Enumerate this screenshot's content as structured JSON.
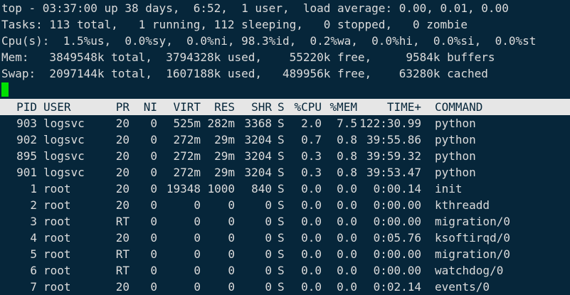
{
  "summary": {
    "uptime": "top - 03:37:00 up 38 days,  6:52,  1 user,  load average: 0.00, 0.01, 0.00",
    "tasks": "Tasks: 113 total,   1 running, 112 sleeping,   0 stopped,   0 zombie",
    "cpu": "Cpu(s):  1.5%us,  0.0%sy,  0.0%ni, 98.3%id,  0.2%wa,  0.0%hi,  0.0%si,  0.0%st",
    "mem": "Mem:   3849548k total,  3794328k used,    55220k free,     9584k buffers",
    "swap": "Swap:  2097144k total,  1607188k used,   489956k free,    63280k cached"
  },
  "colors": {
    "background": "#06263a",
    "foreground": "#dcdcdc",
    "header_bar": "#e6e6e6",
    "cursor": "#00e000"
  },
  "columns": [
    "PID",
    "USER",
    "PR",
    "NI",
    "VIRT",
    "RES",
    "SHR",
    "S",
    "%CPU",
    "%MEM",
    "TIME+",
    "COMMAND"
  ],
  "processes": [
    {
      "pid": "903",
      "user": "logsvc",
      "pr": "20",
      "ni": "0",
      "virt": "525m",
      "res": "282m",
      "shr": "3368",
      "s": "S",
      "cpu": "2.0",
      "mem": "7.5",
      "time": "122:30.99",
      "command": "python"
    },
    {
      "pid": "902",
      "user": "logsvc",
      "pr": "20",
      "ni": "0",
      "virt": "272m",
      "res": "29m",
      "shr": "3204",
      "s": "S",
      "cpu": "0.7",
      "mem": "0.8",
      "time": "39:55.86",
      "command": "python"
    },
    {
      "pid": "895",
      "user": "logsvc",
      "pr": "20",
      "ni": "0",
      "virt": "272m",
      "res": "29m",
      "shr": "3204",
      "s": "S",
      "cpu": "0.3",
      "mem": "0.8",
      "time": "39:59.32",
      "command": "python"
    },
    {
      "pid": "901",
      "user": "logsvc",
      "pr": "20",
      "ni": "0",
      "virt": "272m",
      "res": "29m",
      "shr": "3204",
      "s": "S",
      "cpu": "0.3",
      "mem": "0.8",
      "time": "39:53.47",
      "command": "python"
    },
    {
      "pid": "1",
      "user": "root",
      "pr": "20",
      "ni": "0",
      "virt": "19348",
      "res": "1000",
      "shr": "840",
      "s": "S",
      "cpu": "0.0",
      "mem": "0.0",
      "time": "0:00.14",
      "command": "init"
    },
    {
      "pid": "2",
      "user": "root",
      "pr": "20",
      "ni": "0",
      "virt": "0",
      "res": "0",
      "shr": "0",
      "s": "S",
      "cpu": "0.0",
      "mem": "0.0",
      "time": "0:00.00",
      "command": "kthreadd"
    },
    {
      "pid": "3",
      "user": "root",
      "pr": "RT",
      "ni": "0",
      "virt": "0",
      "res": "0",
      "shr": "0",
      "s": "S",
      "cpu": "0.0",
      "mem": "0.0",
      "time": "0:00.00",
      "command": "migration/0"
    },
    {
      "pid": "4",
      "user": "root",
      "pr": "20",
      "ni": "0",
      "virt": "0",
      "res": "0",
      "shr": "0",
      "s": "S",
      "cpu": "0.0",
      "mem": "0.0",
      "time": "0:05.76",
      "command": "ksoftirqd/0"
    },
    {
      "pid": "5",
      "user": "root",
      "pr": "RT",
      "ni": "0",
      "virt": "0",
      "res": "0",
      "shr": "0",
      "s": "S",
      "cpu": "0.0",
      "mem": "0.0",
      "time": "0:00.00",
      "command": "migration/0"
    },
    {
      "pid": "6",
      "user": "root",
      "pr": "RT",
      "ni": "0",
      "virt": "0",
      "res": "0",
      "shr": "0",
      "s": "S",
      "cpu": "0.0",
      "mem": "0.0",
      "time": "0:00.00",
      "command": "watchdog/0"
    },
    {
      "pid": "7",
      "user": "root",
      "pr": "20",
      "ni": "0",
      "virt": "0",
      "res": "0",
      "shr": "0",
      "s": "S",
      "cpu": "0.0",
      "mem": "0.0",
      "time": "0:02.14",
      "command": "events/0"
    }
  ]
}
